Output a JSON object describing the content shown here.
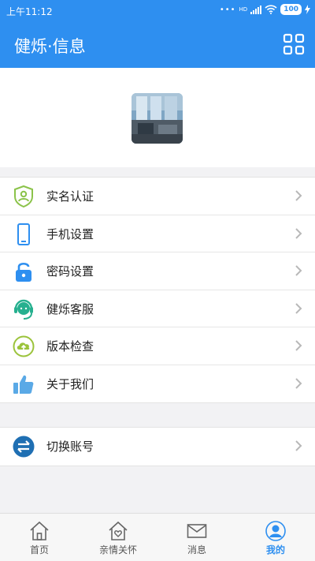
{
  "status_bar": {
    "time": "上午11:12",
    "network": "HD",
    "battery": "100"
  },
  "header": {
    "title": "健烁·信息"
  },
  "menu": [
    {
      "label": "实名认证",
      "icon": "identity-shield-icon"
    },
    {
      "label": "手机设置",
      "icon": "phone-icon"
    },
    {
      "label": "密码设置",
      "icon": "lock-icon"
    },
    {
      "label": "健烁客服",
      "icon": "customer-service-icon"
    },
    {
      "label": "版本检查",
      "icon": "cloud-upload-icon"
    },
    {
      "label": "关于我们",
      "icon": "thumbs-up-icon"
    }
  ],
  "switch_account": {
    "label": "切换账号",
    "icon": "switch-arrows-icon"
  },
  "tabs": [
    {
      "label": "首页",
      "icon": "home-icon",
      "active": false
    },
    {
      "label": "亲情关怀",
      "icon": "family-care-icon",
      "active": false
    },
    {
      "label": "消息",
      "icon": "mail-icon",
      "active": false
    },
    {
      "label": "我的",
      "icon": "user-icon",
      "active": true
    }
  ],
  "colors": {
    "primary": "#2e8ff0",
    "background": "#f2f2f4"
  }
}
